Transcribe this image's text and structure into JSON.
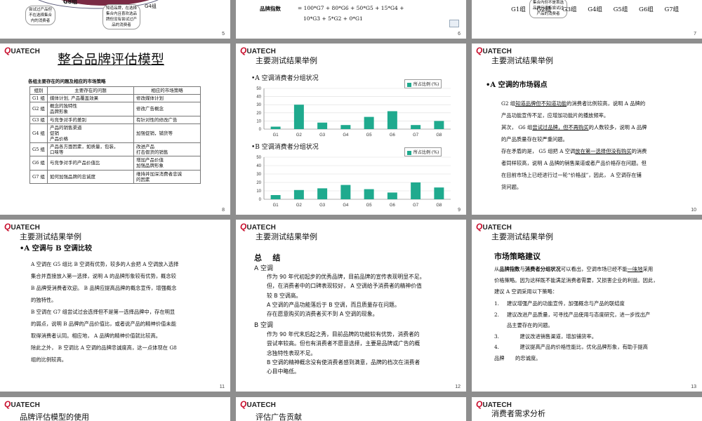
{
  "logo": {
    "q": "Q",
    "rest": "UATECH"
  },
  "slide5": {
    "page": "5",
    "brand_top": "G8组",
    "bubble_left": "尝试过产品但\n不在选择集合\n内的消费者",
    "bubble_mid": "知道品牌，在选择\n集合内且喜欢选品\n牌但没有尝试过产\n品的消费者",
    "g4": "G4组"
  },
  "slide6": {
    "page": "6",
    "formula_label": "品牌指数",
    "formula_line1": "= 100*G7 + 80*G6 + 50*G5 + 15*G4 +",
    "formula_line2": "10*G3 +   5*G2 + 0*G1"
  },
  "slide7": {
    "page": "7",
    "bubble": "集合内但不是首选\n品牌且没有尝试过\n产品的消费者",
    "groups": [
      "G1组",
      "G2组",
      "G3组",
      "G4组",
      "G5组",
      "G6组",
      "G7组"
    ]
  },
  "slide8": {
    "page": "8",
    "title": "整合品牌评估模型",
    "subtitle": "各组主要存在的问题及相应的市场策略",
    "headers": [
      "组别",
      "主要存在的问题",
      "相应的市场策略"
    ],
    "rows": [
      {
        "g": "G1 组",
        "p": "媒体计划, 产品覆盖效果",
        "s": "修改媒体计划"
      },
      {
        "g": "G2 组",
        "p": "概念的独特性\n品牌形象",
        "s": "修改广告概念"
      },
      {
        "g": "G3 组",
        "p": "与竞争对手的差别",
        "s": "有针对性的修改广告"
      },
      {
        "g": "G4 组",
        "p": "产品的销售渠道\n促销\n产品价格",
        "s": "加强促销，铺货等"
      },
      {
        "g": "G5 组",
        "p": "产品各方面因素，如质量，包装，\n口味等",
        "s": "改进产品\n打击假货的销售"
      },
      {
        "g": "G6 组",
        "p": "与竞争对手的产品价值比",
        "s": "增加产品价值\n加强品牌形象"
      },
      {
        "g": "G7 组",
        "p": "如何加强品牌的忠诚度",
        "s": "维持并加深消费者忠诚\n的因素"
      }
    ]
  },
  "slide9": {
    "page": "9",
    "title": "主要测试结果举例",
    "chart_data": [
      {
        "type": "bar",
        "title": "•A 空调消费者分组状况",
        "categories": [
          "G1",
          "G2",
          "G3",
          "G4",
          "G5",
          "G6",
          "G7",
          "G8"
        ],
        "series": [
          {
            "name": "所占比例 (%)",
            "values": [
              3,
              30,
              8,
              5,
              15,
              22,
              5,
              10
            ]
          }
        ],
        "ylim": [
          0,
          50
        ],
        "yticks": [
          0,
          10,
          20,
          30,
          40,
          50
        ],
        "legend": "top-right",
        "color": "#1faa8e"
      },
      {
        "type": "bar",
        "title": "•B 空调消费者分组状况",
        "categories": [
          "G1",
          "G2",
          "G3",
          "G4",
          "G5",
          "G6",
          "G7",
          "G8"
        ],
        "series": [
          {
            "name": "所占比例 (%)",
            "values": [
              5,
              11,
              13,
              17,
              12,
              8,
              20,
              14
            ]
          }
        ],
        "ylim": [
          0,
          50
        ],
        "yticks": [
          0,
          10,
          20,
          30,
          40,
          50
        ],
        "legend": "top-right",
        "color": "#1faa8e"
      }
    ]
  },
  "slide10": {
    "page": "10",
    "title": "主要测试结果举例",
    "heading": "•A 空调的市场弱点",
    "lines": [
      "G2 组知道品牌但不知道功能的消费者比例较高，说明 A 品牌的",
      "产品功能宣传不足，应增加功能片的播放频率。",
      "其次， G6 组尝试过品牌，但不再购买的人数较多，说明 A 品牌",
      "的产品质量存在较严重问题。",
      "存在矛盾的是， G5 组把 A 空调放在第一选择但没有购买的消费",
      "者同样较高，说明 A 品牌的销售渠道或者产品价格存在问题。但",
      "在目前市场上已经进行过一轮“价格战”，因此， A 空调存在铺",
      "货问题。"
    ]
  },
  "slide11": {
    "page": "11",
    "title": "主要测试结果举例",
    "heading": "•A 空调与 B 空调比较",
    "lines": [
      "A 空调在 G5 组比 B 空调有优势，较多的人会把 A 空调放入选择",
      "集合并直接放入第一选择，说明 A 的品牌形象较有优势，概念较",
      "B 品牌受消费者欢迎。 B 品牌应提高品牌的概念宣传，增强概念",
      "的独特性。",
      "B 空调在 G7 组尝试过会选择但不是第一选择品牌中，存在明显",
      "的弱点，说明 B 品牌的产品价值比，或者说产品的精神价值未能",
      "取得消费者认同。相应地， A 品牌的精神价值就比较高。",
      "除此之外， B 空调比 A 空调的品牌忠诚度高，这一点体现在 G8",
      "组的比例较高。"
    ]
  },
  "slide12": {
    "page": "12",
    "title": "主要测试结果举例",
    "heading": "总    结",
    "a_head": "A 空调",
    "a_lines": [
      "作为 90 年代初起步的优秀品牌，目前品牌的宣传表现明显不足。",
      "但，在消费者中的口碑表现较好， A 空调给予消费者的精神价值",
      "较 B 空调高。",
      "A 空调的产品功能落后于 B 空调，而且质量存在问题。",
      "存在愿意购买的消费者买不到 A 空调的现象。"
    ],
    "b_head": "B 空调",
    "b_lines": [
      "作为 90 年代末后起之秀，目前品牌的功能较有优势，消费者的",
      "尝试率较高。但也有消费者不愿意选择，主要是品牌或广告的概",
      "念独特性表现不足。",
      "B 空调的精神概念没有使消费者感到满意，品牌的档次在消费者",
      "心目中略低。"
    ]
  },
  "slide13": {
    "page": "13",
    "title": "主要测试结果举例",
    "heading": "市场策略建议",
    "intro_lines": [
      "从品牌指数与消费者分组状况可以看出，空调市场已经不能一味地采用",
      "价格策略。因为这样既不能满足消费者需要，又损害企业的利益。因此，",
      "建议 A 空调采用以下策略："
    ],
    "items": [
      {
        "n": "1.",
        "t": "建议增强产品的功能宣传，加强概念与产品的联结度"
      },
      {
        "n": "2.",
        "t": "建议改进产品质量，可寻找产品使用与态度研究，进一步找出产"
      },
      {
        "n": "",
        "t": "品主要存在的问题。"
      },
      {
        "n": "3.",
        "t": "        建议改进销售渠道，增加铺货率。"
      },
      {
        "n": "4.",
        "t": "        建议提高产品的价格性能比，优化品牌形象，有助于提高"
      },
      {
        "n": "品牌",
        "t": "的忠诚度。"
      }
    ]
  },
  "slide14": {
    "title": "品牌评估模型的使用"
  },
  "slide15": {
    "title": "评估广告贡献"
  },
  "slide16": {
    "title": "消费者需求分析"
  }
}
